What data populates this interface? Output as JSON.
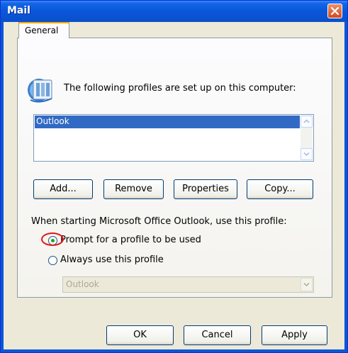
{
  "window": {
    "title": "Mail",
    "titlebar_color": "#0a54d4",
    "close_icon": "close-icon"
  },
  "tabs": [
    {
      "label": "General",
      "selected": true
    }
  ],
  "general": {
    "intro_text": "The following profiles are set up on this computer:",
    "profile_icon": "profile-icon",
    "profiles": [
      {
        "name": "Outlook",
        "selected": true
      }
    ],
    "buttons": {
      "add": "Add...",
      "remove": "Remove",
      "properties": "Properties",
      "copy": "Copy..."
    },
    "startup_group": {
      "label": "When starting Microsoft Office Outlook, use this profile:",
      "options": [
        {
          "label": "Prompt for a profile to be used",
          "checked": true
        },
        {
          "label": "Always use this profile",
          "checked": false
        }
      ],
      "profile_select": {
        "value": "Outlook",
        "disabled": true
      }
    },
    "highlight_color": "#e01818"
  },
  "footer": {
    "ok": "OK",
    "cancel": "Cancel",
    "apply": "Apply"
  }
}
